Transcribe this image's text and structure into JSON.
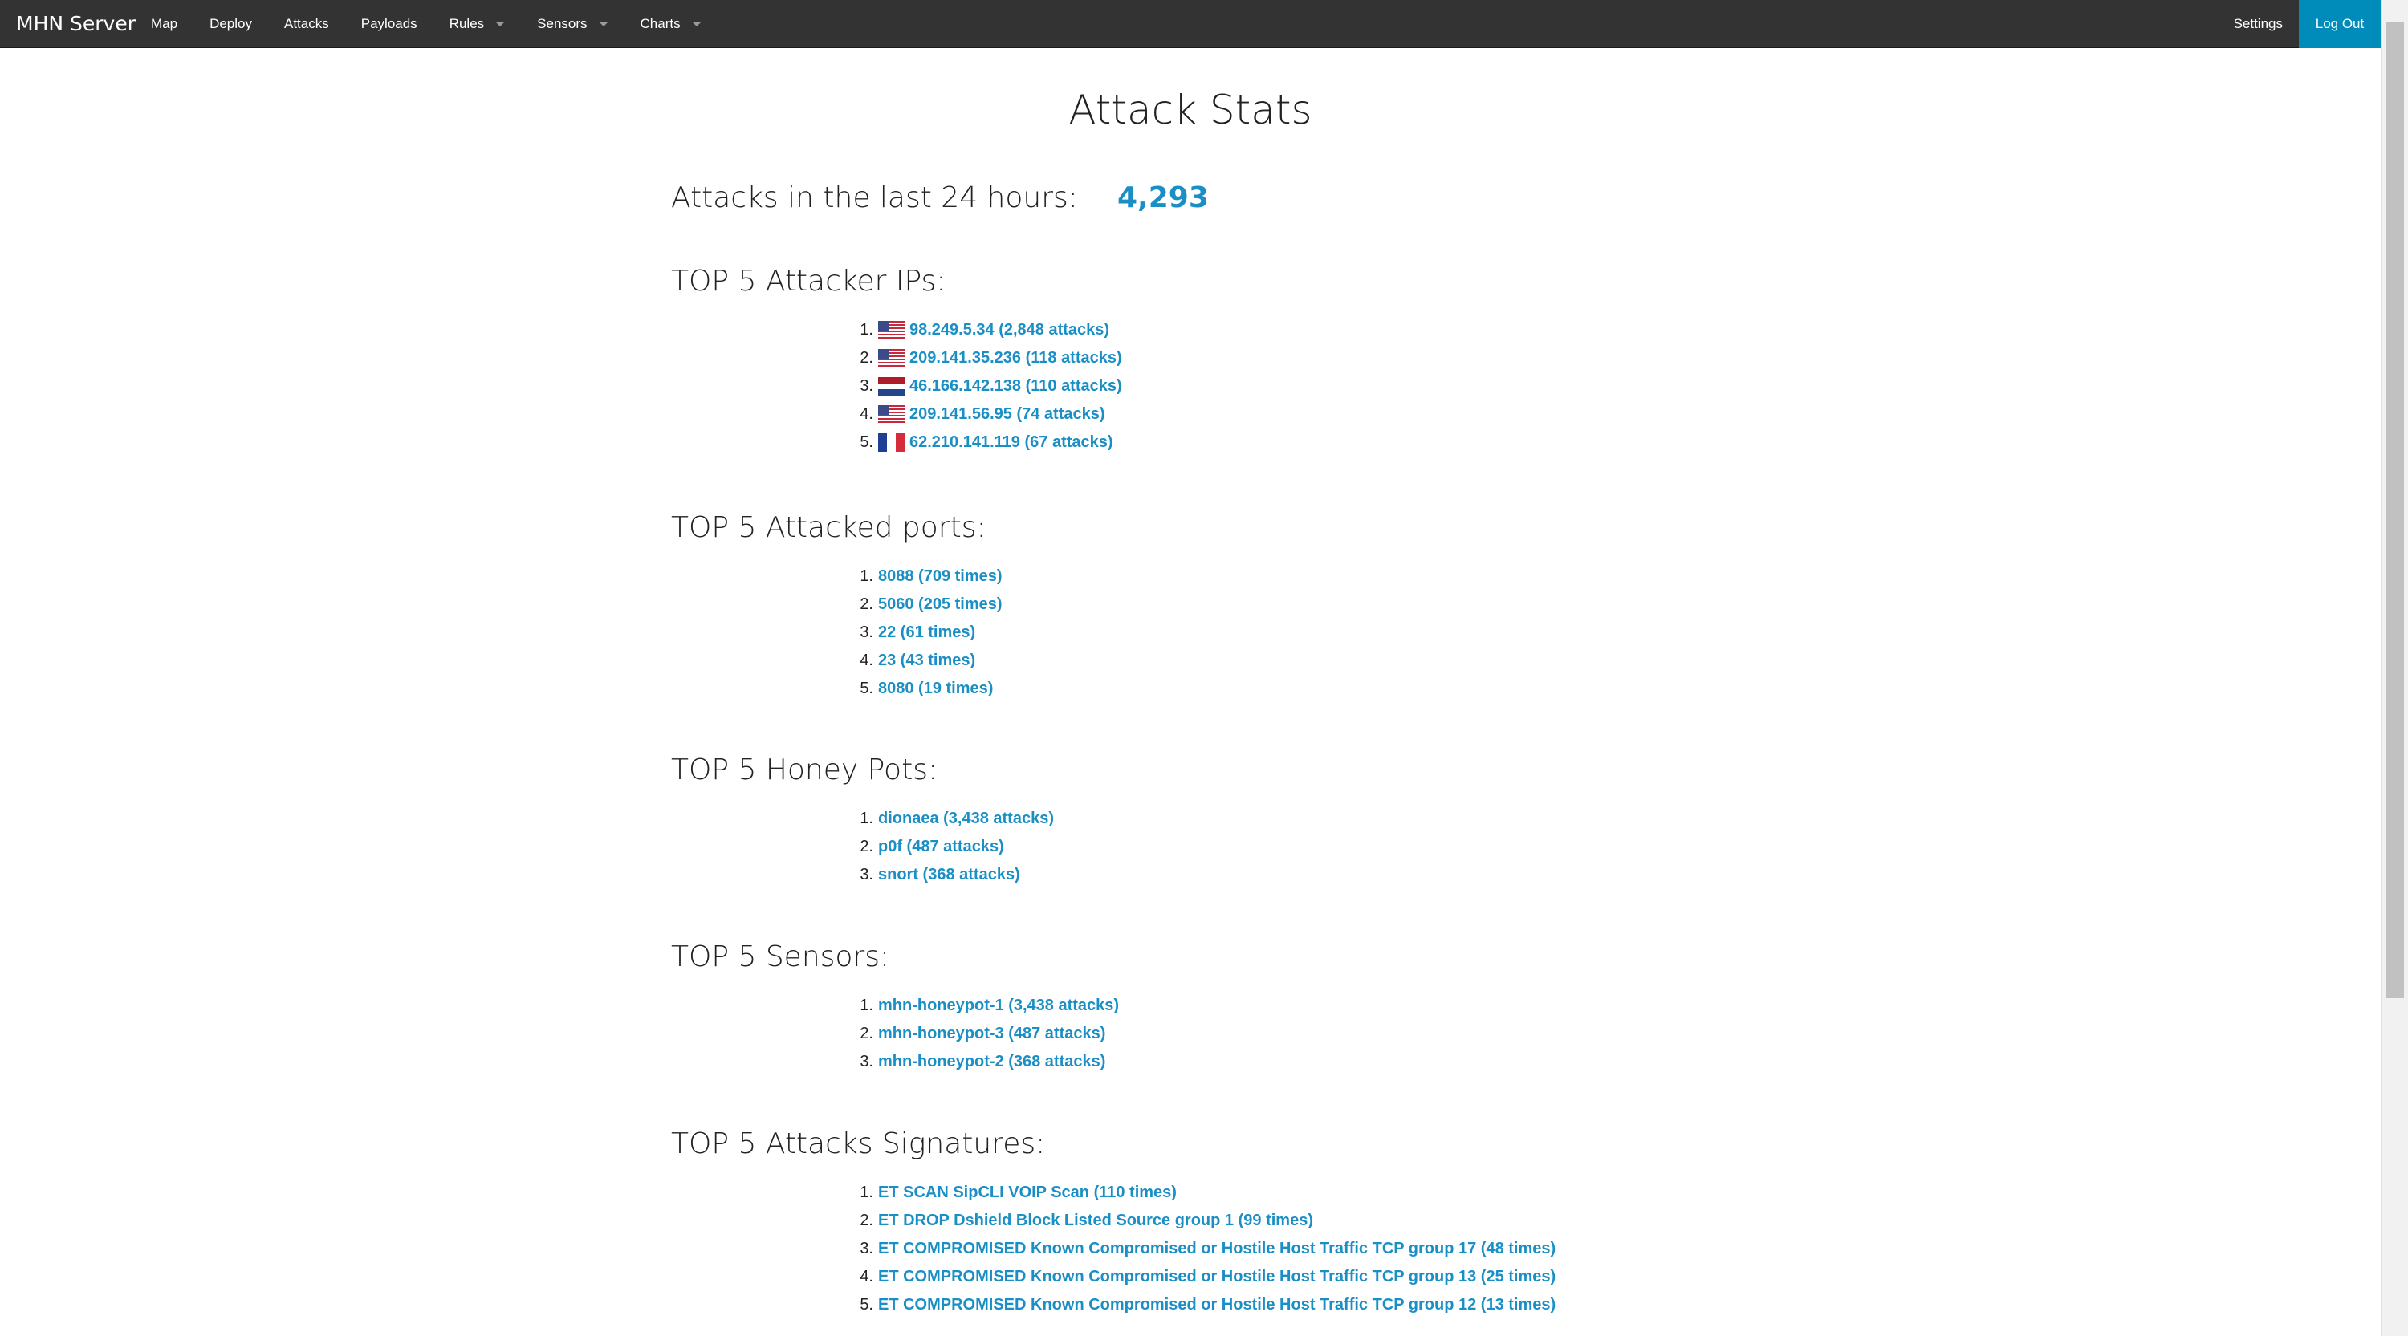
{
  "nav": {
    "brand": "MHN Server",
    "items": [
      {
        "label": "Map",
        "dropdown": false
      },
      {
        "label": "Deploy",
        "dropdown": false
      },
      {
        "label": "Attacks",
        "dropdown": false
      },
      {
        "label": "Payloads",
        "dropdown": false
      },
      {
        "label": "Rules",
        "dropdown": true
      },
      {
        "label": "Sensors",
        "dropdown": true
      },
      {
        "label": "Charts",
        "dropdown": true
      }
    ],
    "settings": "Settings",
    "logout": "Log Out"
  },
  "page": {
    "title": "Attack Stats",
    "attacks_label": "Attacks in the last 24 hours:",
    "attacks_count": "4,293"
  },
  "sections": {
    "ips": {
      "heading": "TOP 5 Attacker IPs:",
      "items": [
        {
          "num": "1.",
          "flag": "us-flag-icon",
          "text": "98.249.5.34 (2,848 attacks)"
        },
        {
          "num": "2.",
          "flag": "us-flag-icon",
          "text": "209.141.35.236 (118 attacks)"
        },
        {
          "num": "3.",
          "flag": "nl-flag-icon",
          "text": "46.166.142.138 (110 attacks)"
        },
        {
          "num": "4.",
          "flag": "us-flag-icon",
          "text": "209.141.56.95 (74 attacks)"
        },
        {
          "num": "5.",
          "flag": "fr-flag-icon",
          "text": "62.210.141.119 (67 attacks)"
        }
      ]
    },
    "ports": {
      "heading": "TOP 5 Attacked ports:",
      "items": [
        {
          "num": "1.",
          "text": "8088 (709 times)"
        },
        {
          "num": "2.",
          "text": "5060 (205 times)"
        },
        {
          "num": "3.",
          "text": "22 (61 times)"
        },
        {
          "num": "4.",
          "text": "23 (43 times)"
        },
        {
          "num": "5.",
          "text": "8080 (19 times)"
        }
      ]
    },
    "honeypots": {
      "heading": "TOP 5 Honey Pots:",
      "items": [
        {
          "num": "1.",
          "text": "dionaea (3,438 attacks)"
        },
        {
          "num": "2.",
          "text": "p0f (487 attacks)"
        },
        {
          "num": "3.",
          "text": "snort (368 attacks)"
        }
      ]
    },
    "sensors": {
      "heading": "TOP 5 Sensors:",
      "items": [
        {
          "num": "1.",
          "text": "mhn-honeypot-1 (3,438 attacks)"
        },
        {
          "num": "2.",
          "text": "mhn-honeypot-3 (487 attacks)"
        },
        {
          "num": "3.",
          "text": "mhn-honeypot-2 (368 attacks)"
        }
      ]
    },
    "signatures": {
      "heading": "TOP 5 Attacks Signatures:",
      "items": [
        {
          "num": "1.",
          "text": "ET SCAN SipCLI VOIP Scan (110 times)"
        },
        {
          "num": "2.",
          "text": "ET DROP Dshield Block Listed Source group 1 (99 times)"
        },
        {
          "num": "3.",
          "text": "ET COMPROMISED Known Compromised or Hostile Host Traffic TCP group 17 (48 times)"
        },
        {
          "num": "4.",
          "text": "ET COMPROMISED Known Compromised or Hostile Host Traffic TCP group 13 (25 times)"
        },
        {
          "num": "5.",
          "text": "ET COMPROMISED Known Compromised or Hostile Host Traffic TCP group 12 (13 times)"
        }
      ]
    }
  },
  "colors": {
    "topbar": "#333333",
    "accent": "#008cba",
    "link": "#1a8fc6"
  }
}
